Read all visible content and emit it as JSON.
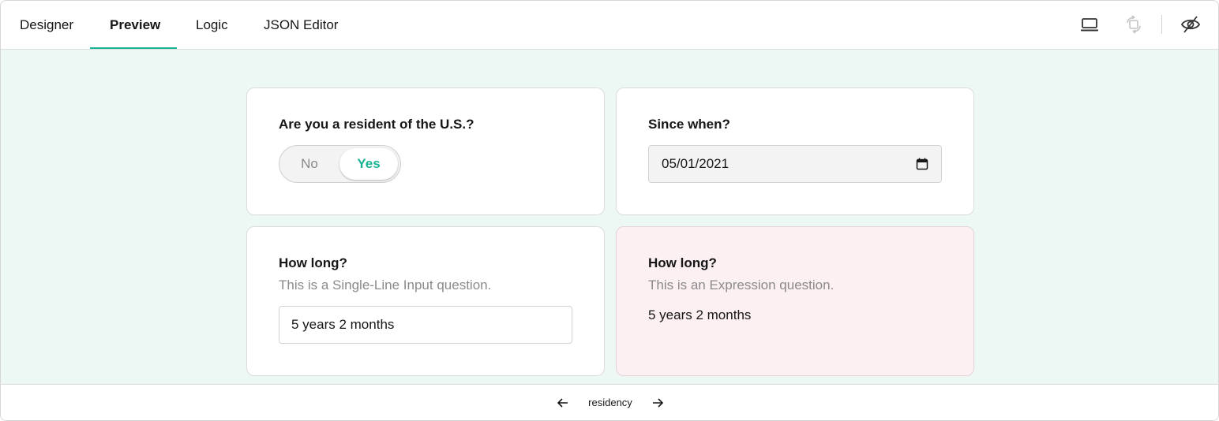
{
  "tabs": [
    {
      "label": "Designer"
    },
    {
      "label": "Preview",
      "active": true
    },
    {
      "label": "Logic"
    },
    {
      "label": "JSON Editor"
    }
  ],
  "toolbar": {
    "device_icon": "laptop-icon",
    "orientation_icon": "rotate-orientation-icon",
    "visibility_icon": "eye-slash-icon"
  },
  "questions": {
    "resident": {
      "title": "Are you a resident of the U.S.?",
      "options": [
        "No",
        "Yes"
      ],
      "selected": "Yes"
    },
    "since": {
      "title": "Since when?",
      "value": "05/01/2021"
    },
    "how_long_input": {
      "title": "How long?",
      "description": "This is a Single-Line Input question.",
      "value": "5 years 2 months"
    },
    "how_long_expression": {
      "title": "How long?",
      "description": "This is an Expression question.",
      "value": "5 years 2 months"
    }
  },
  "pager": {
    "page_name": "residency",
    "prev_icon": "arrow-left-icon",
    "next_icon": "arrow-right-icon"
  },
  "colors": {
    "accent": "#19b394",
    "canvas_bg": "#edf7f4",
    "error_bg": "#fcf0f2"
  }
}
